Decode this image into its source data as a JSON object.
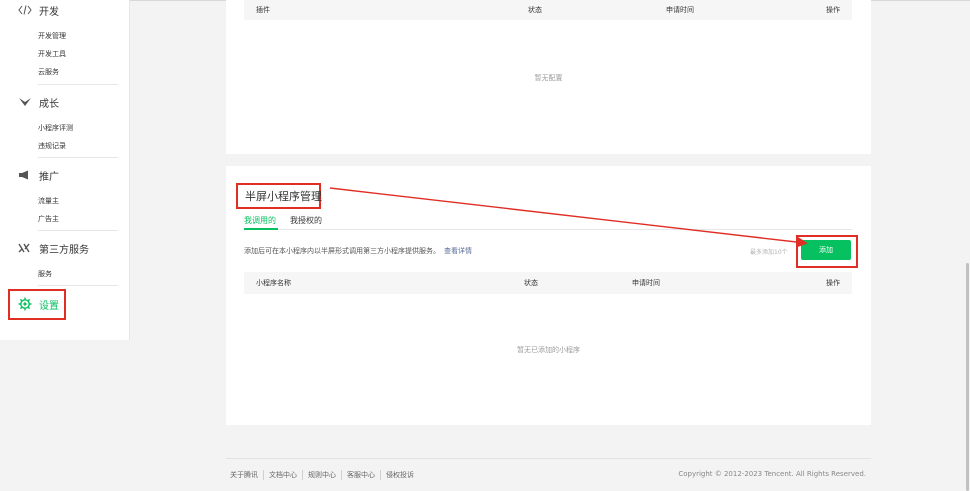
{
  "sidebar": {
    "dev": {
      "title": "开发",
      "icon": "code-icon",
      "items": [
        "开发管理",
        "开发工具",
        "云服务"
      ]
    },
    "growth": {
      "title": "成长",
      "icon": "growth-icon",
      "items": [
        "小程序评测",
        "违规记录"
      ]
    },
    "promo": {
      "title": "推广",
      "icon": "megaphone-icon",
      "items": [
        "流量主",
        "广告主"
      ]
    },
    "thirdparty": {
      "title": "第三方服务",
      "icon": "thirdparty-icon",
      "items": [
        "服务"
      ]
    },
    "settings": {
      "title": "设置",
      "icon": "gear-icon"
    }
  },
  "top_table": {
    "columns": [
      "插件",
      "状态",
      "申请时间",
      "操作"
    ],
    "empty": "暂无配置"
  },
  "half_screen": {
    "title": "半屏小程序管理",
    "tabs": [
      "我调用的",
      "我授权的"
    ],
    "description": "添加后可在本小程序内以半屏形式调用第三方小程序提供服务。",
    "details_link": "查看详情",
    "limit_note": "最多添加10个",
    "add_button": "添加",
    "columns": [
      "小程序名称",
      "状态",
      "申请时间",
      "操作"
    ],
    "empty": "暂无已添加的小程序"
  },
  "footer": {
    "links": [
      "关于腾讯",
      "文档中心",
      "规则中心",
      "客服中心",
      "侵权投诉"
    ],
    "copyright": "Copyright © 2012-2023 Tencent. All Rights Reserved."
  },
  "colors": {
    "accent": "#07c160",
    "annotation": "#e02e24",
    "link": "#576b95"
  }
}
